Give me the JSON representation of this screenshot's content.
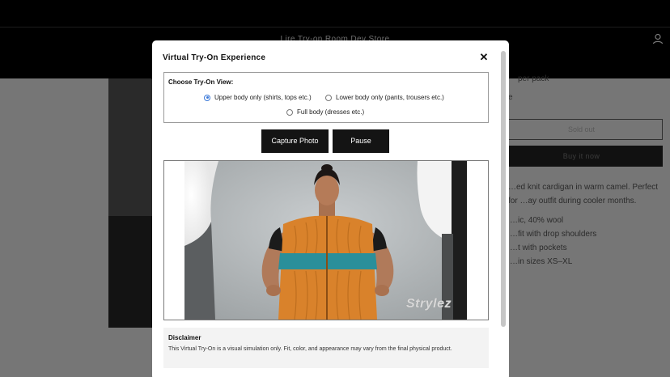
{
  "store": {
    "title": "Lire Try-on Room Dev Store",
    "buttons": {
      "sold_out": "Sold out",
      "buy_now": "Buy it now"
    },
    "snippets": {
      "price_fragment": "per pack",
      "qty_fragment": "e"
    },
    "description": "…ed knit cardigan in warm camel. Perfect for …ay outfit during cooler months.",
    "features": [
      "…ic, 40% wool",
      "…fit with drop shoulders",
      "…t with pockets",
      "…in sizes XS–XL"
    ]
  },
  "modal": {
    "title": "Virtual Try-On Experience",
    "close_label": "✕",
    "view_selector": {
      "label": "Choose Try-On View:",
      "options": [
        {
          "label": "Upper body only (shirts, tops etc.)",
          "checked": true
        },
        {
          "label": "Lower body only (pants, trousers etc.)",
          "checked": false
        },
        {
          "label": "Full body (dresses etc.)",
          "checked": false
        }
      ]
    },
    "buttons": {
      "capture": "Capture Photo",
      "pause": "Pause"
    },
    "camera": {
      "watermark": "Strylez"
    },
    "disclaimer": {
      "title": "Disclaimer",
      "text": "This Virtual Try-On is a visual simulation only. Fit, color, and appearance may vary from the final physical product."
    }
  },
  "colors": {
    "accent_radio": "#3a78d8",
    "button_dark": "#141414",
    "sweater_orange": "#d9822b",
    "sweater_teal": "#2a8f9a"
  }
}
